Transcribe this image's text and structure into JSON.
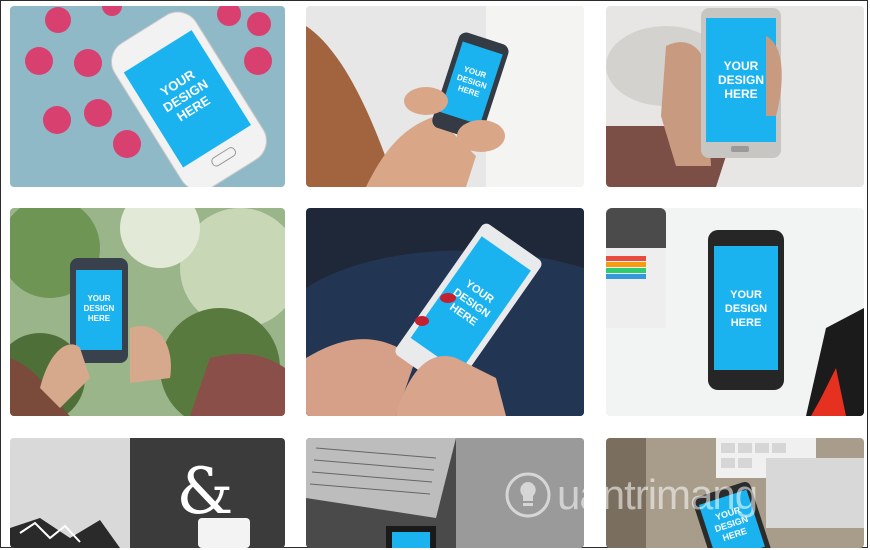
{
  "gallery": {
    "screen_text": [
      "YOUR",
      "DESIGN",
      "HERE"
    ],
    "accent": "#1ab3f0",
    "tiles": [
      {
        "scene": "pink-candies-white-phone"
      },
      {
        "scene": "woman-hands-dark-phone"
      },
      {
        "scene": "hand-holding-silver-phone"
      },
      {
        "scene": "hands-phone-garden"
      },
      {
        "scene": "red-nails-white-phone"
      },
      {
        "scene": "black-phone-desk-camera"
      },
      {
        "scene": "ampersand-decor"
      },
      {
        "scene": "laptop-phone-desk"
      },
      {
        "scene": "keyboard-tablet-phone"
      }
    ]
  },
  "watermark": {
    "text": "uantrimang",
    "icon": "lightbulb-icon"
  }
}
